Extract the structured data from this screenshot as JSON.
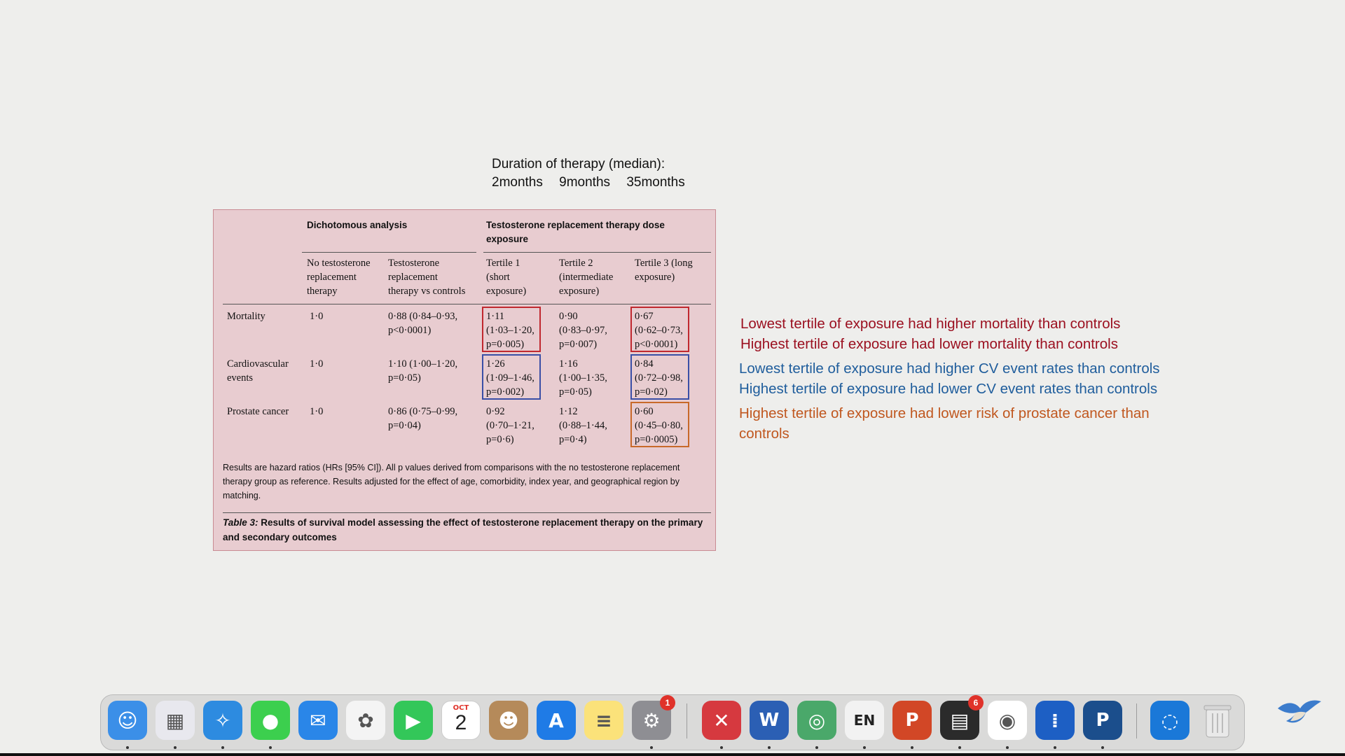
{
  "duration": {
    "title": "Duration of therapy (median):",
    "months": [
      "2months",
      "9months",
      "35months"
    ]
  },
  "table": {
    "group_headers": {
      "dichotomous": "Dichotomous analysis",
      "dose_line1": "Testosterone replacement therapy dose",
      "dose_line2": "exposure"
    },
    "columns": [
      [
        "No testosterone",
        "replacement",
        "therapy"
      ],
      [
        "Testosterone",
        "replacement",
        "therapy vs controls"
      ],
      [
        "Tertile 1",
        "(short",
        "exposure)"
      ],
      [
        "Tertile 2",
        "(intermediate",
        "exposure)"
      ],
      [
        "Tertile 3 (long",
        "exposure)"
      ]
    ],
    "rows": [
      {
        "label": [
          "Mortality"
        ],
        "cells": [
          [
            "1·0"
          ],
          [
            "0·88 (0·84–0·93,",
            "p<0·0001)"
          ],
          [
            "1·11",
            "(1·03–1·20,",
            "p=0·005)"
          ],
          [
            "0·90",
            "(0·83–0·97,",
            "p=0·007)"
          ],
          [
            "0·67",
            "(0·62–0·73,",
            "p<0·0001)"
          ]
        ]
      },
      {
        "label": [
          "Cardiovascular",
          "events"
        ],
        "cells": [
          [
            "1·0"
          ],
          [
            "1·10 (1·00–1·20,",
            "p=0·05)"
          ],
          [
            "1·26",
            "(1·09–1·46,",
            "p=0·002)"
          ],
          [
            "1·16",
            "(1·00–1·35,",
            "p=0·05)"
          ],
          [
            "0·84",
            "(0·72–0·98,",
            "p=0·02)"
          ]
        ]
      },
      {
        "label": [
          "Prostate cancer"
        ],
        "cells": [
          [
            "1·0"
          ],
          [
            "0·86 (0·75–0·99,",
            "p=0·04)"
          ],
          [
            "0·92",
            "(0·70–1·21,",
            "p=0·6)"
          ],
          [
            "1·12",
            "(0·88–1·44,",
            "p=0·4)"
          ],
          [
            "0·60",
            "(0·45–0·80,",
            "p=0·0005)"
          ]
        ]
      }
    ],
    "footnote": "Results are hazard ratios (HRs [95% CI]). All p values derived from comparisons with the no testosterone replacement therapy group as reference. Results adjusted for the effect of age, comorbidity, index year, and geographical region by matching.",
    "caption_label": "Table 3:",
    "caption_text": " Results of survival model assessing the effect of testosterone replacement therapy on the primary and secondary outcomes",
    "box_colors": {
      "mortality": "#c0282f",
      "cv": "#3a4fa6",
      "prostate": "#c8692a"
    }
  },
  "annotations": [
    {
      "text": "Lowest tertile of exposure had higher mortality than controls",
      "color": "#9b1020"
    },
    {
      "text": "Highest tertile of exposure had lower mortality than controls",
      "color": "#9b1020"
    },
    {
      "text": "Lowest tertile of exposure had higher CV event rates than controls",
      "color": "#1f5d9c"
    },
    {
      "text": "Highest tertile of exposure had lower CV event rates than controls",
      "color": "#1f5d9c"
    },
    {
      "text": "Highest tertile of exposure had lower risk of prostate cancer than",
      "color": "#c0571f"
    },
    {
      "text": "controls",
      "color": "#c0571f"
    }
  ],
  "dock": {
    "apps": [
      {
        "name": "finder-icon",
        "label": "",
        "bg": "#3b8fe8",
        "running": true
      },
      {
        "name": "launchpad-icon",
        "label": "",
        "bg": "#e8e8ee",
        "running": true
      },
      {
        "name": "safari-icon",
        "label": "",
        "bg": "#2d8be0",
        "running": true
      },
      {
        "name": "messages-icon",
        "label": "",
        "bg": "#3ccf4e",
        "running": true
      },
      {
        "name": "mail-icon",
        "label": "",
        "bg": "#2a86e8",
        "running": false
      },
      {
        "name": "photos-icon",
        "label": "",
        "bg": "#f4f4f4",
        "running": false
      },
      {
        "name": "facetime-icon",
        "label": "",
        "bg": "#33c759",
        "running": false
      },
      {
        "name": "calendar-icon",
        "label": "",
        "bg": "#ffffff",
        "running": false,
        "month": "OCT",
        "day": "2"
      },
      {
        "name": "contacts-icon",
        "label": "",
        "bg": "#b58a5a",
        "running": false
      },
      {
        "name": "app-store-icon",
        "label": "",
        "bg": "#1f7be6",
        "running": false
      },
      {
        "name": "notes-icon",
        "label": "",
        "bg": "#fbe27a",
        "running": false
      },
      {
        "name": "system-settings-icon",
        "label": "",
        "bg": "#8e8e93",
        "running": true,
        "badge": "1"
      },
      {
        "name": "remote-desktop-icon",
        "label": "",
        "bg": "#d6393f",
        "running": true
      },
      {
        "name": "word-icon",
        "label": "W",
        "bg": "#2b5fb4",
        "running": true
      },
      {
        "name": "globe-app-icon",
        "label": "",
        "bg": "#4aa86a",
        "running": true
      },
      {
        "name": "input-source-icon",
        "label": "EN",
        "bg": "#f2f2f2",
        "running": true
      },
      {
        "name": "powerpoint-icon",
        "label": "P",
        "bg": "#d24726",
        "running": true
      },
      {
        "name": "printer-icon",
        "label": "",
        "bg": "#2b2b2b",
        "running": true,
        "badge": "6"
      },
      {
        "name": "chrome-icon",
        "label": "",
        "bg": "#ffffff",
        "running": true
      },
      {
        "name": "dots-app-icon",
        "label": "",
        "bg": "#1d5fc4",
        "running": true
      },
      {
        "name": "p-power-icon",
        "label": "P",
        "bg": "#1b4e8c",
        "running": true
      },
      {
        "name": "spiral-app-icon",
        "label": "",
        "bg": "#1a78d8",
        "running": false
      },
      {
        "name": "trash-icon",
        "label": "",
        "bg": "transparent",
        "running": false
      }
    ]
  }
}
